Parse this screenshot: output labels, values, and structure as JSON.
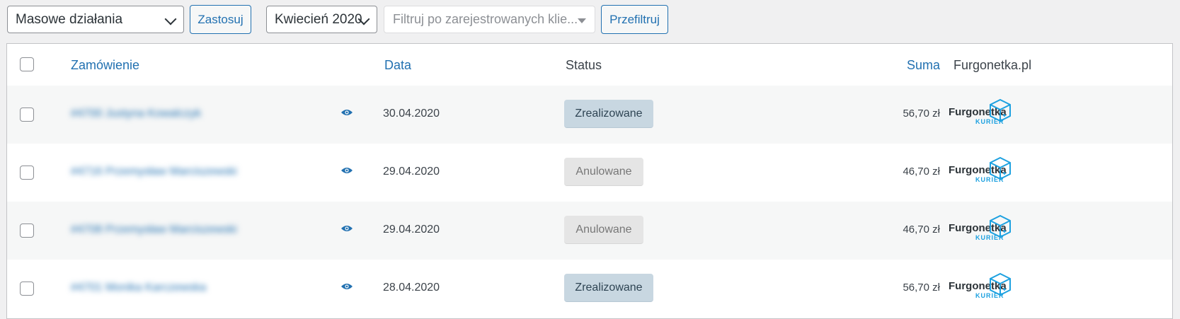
{
  "toolbar": {
    "bulk_actions": "Masowe działania",
    "apply": "Zastosuj",
    "month": "Kwiecień 2020",
    "customer_filter_placeholder": "Filtruj po zarejestrowanych klie...",
    "filter": "Przefiltruj"
  },
  "table": {
    "headers": {
      "order": "Zamówienie",
      "date": "Data",
      "status": "Status",
      "total": "Suma",
      "shipping": "Furgonetka.pl"
    },
    "rows": [
      {
        "name": "#4700 Justyna Kowalczyk",
        "date": "30.04.2020",
        "status": "Zrealizowane",
        "status_type": "completed",
        "total": "56,70 zł"
      },
      {
        "name": "#4716 Przemysław Marciszewski",
        "date": "29.04.2020",
        "status": "Anulowane",
        "status_type": "cancelled",
        "total": "46,70 zł"
      },
      {
        "name": "#4708 Przemysław Marciszewski",
        "date": "29.04.2020",
        "status": "Anulowane",
        "status_type": "cancelled",
        "total": "46,70 zł"
      },
      {
        "name": "#4701 Monika Karczewska",
        "date": "28.04.2020",
        "status": "Zrealizowane",
        "status_type": "completed",
        "total": "56,70 zł"
      }
    ]
  },
  "logo": {
    "brand": "Furgonetka",
    "sub": "KURIER"
  },
  "colors": {
    "accent": "#2271b1",
    "completed_bg": "#c8d7e1",
    "cancelled_bg": "#e5e5e5",
    "logo_blue": "#1da1e0"
  },
  "icons": [
    "chevron-down-icon",
    "dropdown-triangle-icon",
    "eye-icon",
    "box-icon"
  ]
}
